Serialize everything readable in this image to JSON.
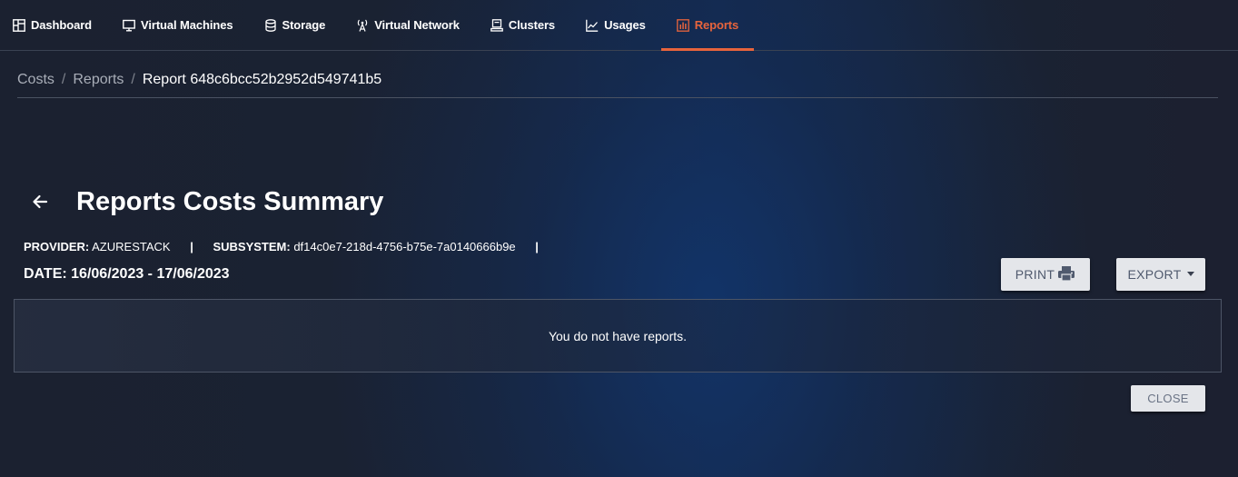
{
  "nav": {
    "items": [
      {
        "label": "Dashboard",
        "icon": "dashboard-icon"
      },
      {
        "label": "Virtual Machines",
        "icon": "monitor-icon"
      },
      {
        "label": "Storage",
        "icon": "database-icon"
      },
      {
        "label": "Virtual Network",
        "icon": "antenna-icon"
      },
      {
        "label": "Clusters",
        "icon": "server-icon"
      },
      {
        "label": "Usages",
        "icon": "chart-line-icon"
      },
      {
        "label": "Reports",
        "icon": "report-icon"
      }
    ],
    "active": "Reports",
    "accent_color": "#e8643c"
  },
  "breadcrumb": {
    "items": [
      "Costs",
      "Reports"
    ],
    "separator": "/",
    "current": "Report 648c6bcc52b2952d549741b5"
  },
  "header": {
    "title": "Reports Costs Summary",
    "provider_label": "PROVIDER:",
    "provider_value": "AZURESTACK",
    "subsystem_label": "SUBSYSTEM:",
    "subsystem_value": "df14c0e7-218d-4756-b75e-7a0140666b9e",
    "pipe": "|",
    "date_label": "DATE:",
    "date_value": "16/06/2023 - 17/06/2023"
  },
  "actions": {
    "print_label": "PRINT",
    "export_label": "EXPORT",
    "close_label": "CLOSE"
  },
  "empty_state": {
    "message": "You do not have reports."
  }
}
